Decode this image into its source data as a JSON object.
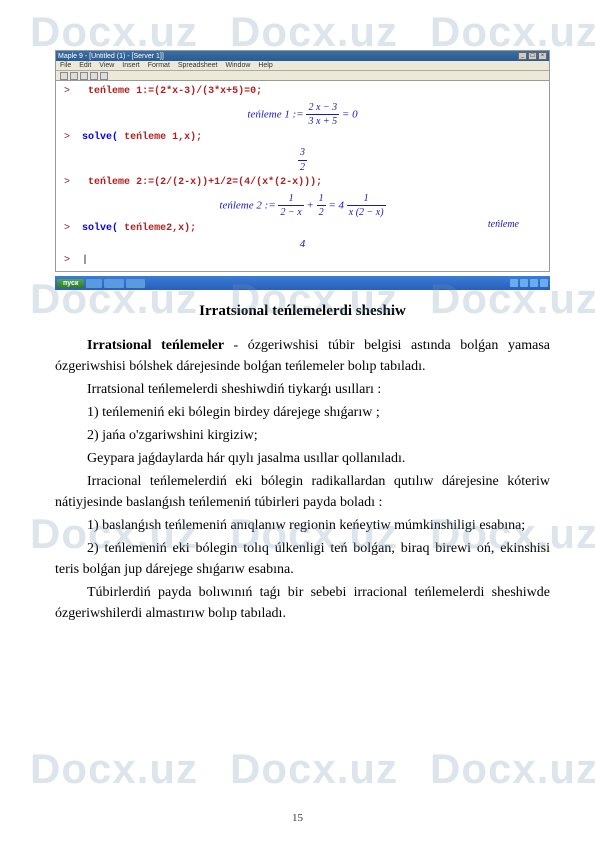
{
  "watermark": "Docx.uz",
  "window": {
    "title": "Maple 9 - [Untitled (1) - [Server 1]]",
    "menu": [
      "File",
      "Edit",
      "View",
      "Insert",
      "Format",
      "Spreadsheet",
      "Window",
      "Help"
    ]
  },
  "code": {
    "prompt": ">",
    "line1_label": "teńleme",
    "line1_code": "1:=(2*x-3)/(3*x+5)=0;",
    "formula1_label": "teńleme 1",
    "formula1_num": "2 x − 3",
    "formula1_den": "3 x + 5",
    "formula1_rhs": " = 0",
    "line2_kw": "solve(",
    "line2_arg_label": "teńleme",
    "line2_arg_rest": " 1,x);",
    "output1_num": "3",
    "output1_den": "2",
    "line3_label": "teńleme",
    "line3_code": "2:=(2/(2-x))+1/2=(4/(x*(2-x)));",
    "formula2_label": "teńleme",
    "formula2_eqn": "2",
    "formula2_f1num": "1",
    "formula2_f1den": "2 − x",
    "formula2_plus": " + ",
    "formula2_f2num": "1",
    "formula2_f2den": "2",
    "formula2_eq4": " = 4 ",
    "formula2_f3num": "1",
    "formula2_f3den": "x (2 − x)",
    "line4_kw": "solve(",
    "line4_arg_label": "teńleme",
    "line4_arg_rest": "2,x);",
    "output2": "4",
    "tenleme_side": "teńleme"
  },
  "taskbar": {
    "start": "пуск",
    "items": [
      "",
      "",
      ""
    ]
  },
  "doc": {
    "title": "Irratsional teńlemelerdi sheshiw",
    "p1_lead": "Irratsional teńlemeler ",
    "p1_rest": " - ózgeriwshisi túbir belgisi astında bolǵan yamasa ózgeriwshisi bólshek dárejesinde bolǵan teńlemeler bolıp tabıladı.",
    "p2": " Irratsional teńlemelerdi sheshiwdiń tiykarǵı usılları :",
    "p3": "1) teńlemeniń eki bólegin birdey dárejege shıǵarıw ;",
    "p4": "2) jańa o'zgariwshini kirgiziw;",
    "p5": "Geypara jaǵdaylarda hár qıylı jasalma usıllar qollanıladı.",
    "p6": "Irracional teńlemelerdiń eki bólegin radikallardan qutılıw dárejesine kóteriw nátiyjesinde baslanǵısh teńlemeniń túbirleri payda boladı :",
    "p7": "1) baslanǵısh teńlemeniń anıqlanıw regionin keńeytiw múmkinshiligi esabına;",
    "p8": "2) teńlemeniń eki bólegin tolıq úlkenligi teń bolǵan, biraq birewi oń, ekinshisi teris bolǵan jup dárejege shıǵarıw esabına.",
    "p9": "Túbirlerdiń payda bolıwınıń taǵı bir sebebi irracional teńlemelerdi sheshiwde ózgeriwshilerdi almastırıw bolıp tabıladı."
  },
  "page_number": "15"
}
